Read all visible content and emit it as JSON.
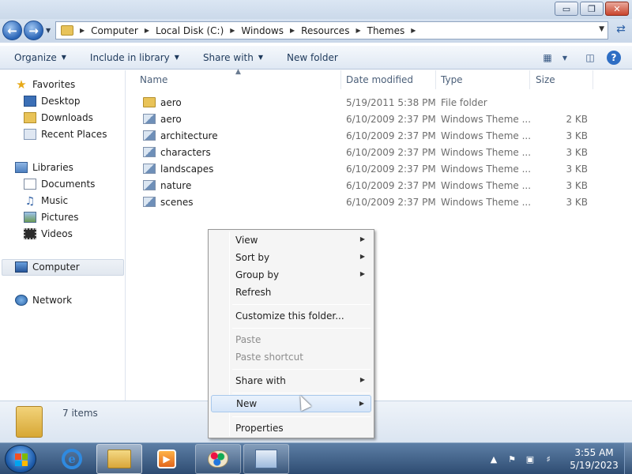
{
  "window": {
    "controls": {
      "minimize": "▭",
      "maximize": "❐",
      "close": "✕"
    }
  },
  "address": {
    "path": [
      "Computer",
      "Local Disk (C:)",
      "Windows",
      "Resources",
      "Themes"
    ],
    "separator": "▶"
  },
  "toolbar": {
    "organize": "Organize",
    "include_in_library": "Include in library",
    "share_with": "Share with",
    "new_folder": "New folder",
    "dropdown_glyph": "▼"
  },
  "nav": {
    "favorites": "Favorites",
    "desktop": "Desktop",
    "downloads": "Downloads",
    "recent_places": "Recent Places",
    "libraries": "Libraries",
    "documents": "Documents",
    "music": "Music",
    "pictures": "Pictures",
    "videos": "Videos",
    "computer": "Computer",
    "network": "Network"
  },
  "columns": {
    "name": "Name",
    "date_modified": "Date modified",
    "type": "Type",
    "size": "Size"
  },
  "files": [
    {
      "name": "aero",
      "date": "5/19/2011 5:38 PM",
      "type": "File folder",
      "size": "",
      "icon": "folder-icon"
    },
    {
      "name": "aero",
      "date": "6/10/2009 2:37 PM",
      "type": "Windows Theme ...",
      "size": "2 KB",
      "icon": "theme-file-icon"
    },
    {
      "name": "architecture",
      "date": "6/10/2009 2:37 PM",
      "type": "Windows Theme ...",
      "size": "3 KB",
      "icon": "theme-file-icon"
    },
    {
      "name": "characters",
      "date": "6/10/2009 2:37 PM",
      "type": "Windows Theme ...",
      "size": "3 KB",
      "icon": "theme-file-icon"
    },
    {
      "name": "landscapes",
      "date": "6/10/2009 2:37 PM",
      "type": "Windows Theme ...",
      "size": "3 KB",
      "icon": "theme-file-icon"
    },
    {
      "name": "nature",
      "date": "6/10/2009 2:37 PM",
      "type": "Windows Theme ...",
      "size": "3 KB",
      "icon": "theme-file-icon"
    },
    {
      "name": "scenes",
      "date": "6/10/2009 2:37 PM",
      "type": "Windows Theme ...",
      "size": "3 KB",
      "icon": "theme-file-icon"
    }
  ],
  "details": {
    "item_count": "7 items"
  },
  "context_menu": {
    "view": "View",
    "sort_by": "Sort by",
    "group_by": "Group by",
    "refresh": "Refresh",
    "customize": "Customize this folder...",
    "paste": "Paste",
    "paste_shortcut": "Paste shortcut",
    "share_with": "Share with",
    "new": "New",
    "properties": "Properties",
    "submenu_glyph": "▶"
  },
  "taskbar": {
    "time": "3:55 AM",
    "date": "5/19/2023",
    "ie_glyph": "e"
  },
  "colors": {
    "accent": "#2e6ec4",
    "menu_highlight": "#d5e5f8",
    "taskbar": "#2e4c72"
  }
}
